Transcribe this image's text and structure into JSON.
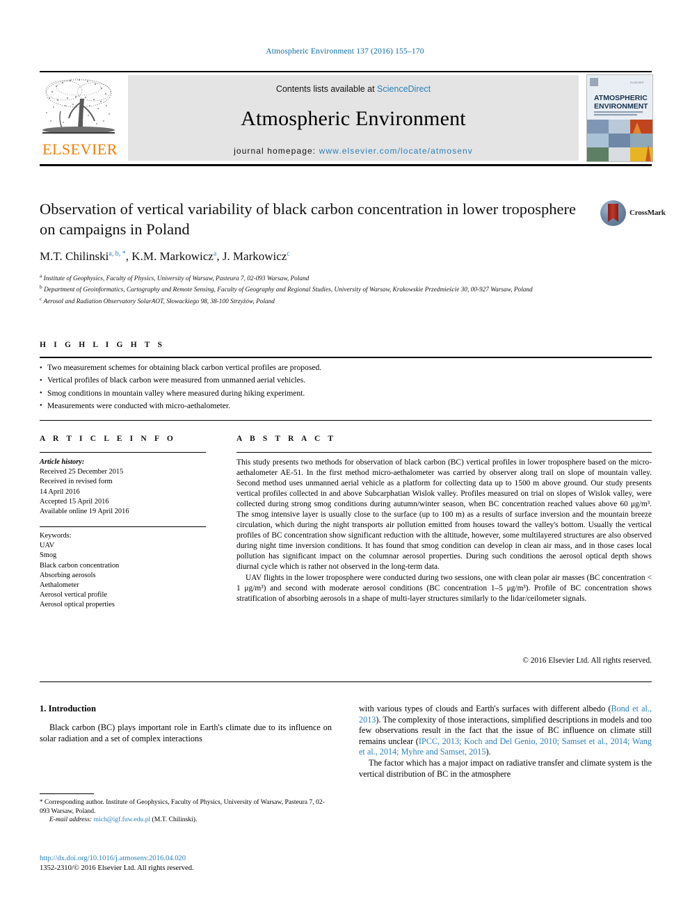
{
  "running_head": "Atmospheric Environment 137 (2016) 155–170",
  "masthead": {
    "contents_prefix": "Contents lists available at ",
    "sciencedirect": "ScienceDirect",
    "journal_title": "Atmospheric Environment",
    "homepage_prefix": "journal homepage: ",
    "homepage_url": "www.elsevier.com/locate/atmosenv",
    "publisher_wordmark": "ELSEVIER",
    "cover_title_line1": "ATMOSPHERIC",
    "cover_title_line2": "ENVIRONMENT"
  },
  "article": {
    "title": "Observation of vertical variability of black carbon concentration in lower troposphere on campaigns in Poland",
    "authors": [
      {
        "name": "M.T. Chilinski",
        "marks": "a, b, *"
      },
      {
        "name": "K.M. Markowicz",
        "marks": "a"
      },
      {
        "name": "J. Markowicz",
        "marks": "c"
      }
    ],
    "affiliations": [
      {
        "mark": "a",
        "text": "Institute of Geophysics, Faculty of Physics, University of Warsaw, Pasteura 7, 02-093 Warsaw, Poland"
      },
      {
        "mark": "b",
        "text": "Department of Geoinformatics, Cartography and Remote Sensing, Faculty of Geography and Regional Studies, University of Warsaw, Krakowskie Przedmieście 30, 00-927 Warsaw, Poland"
      },
      {
        "mark": "c",
        "text": "Aerosol and Radiation Observatory SolarAOT, Słowackiego 98, 38-100 Strzyżów, Poland"
      }
    ],
    "crossmark_label": "CrossMark"
  },
  "highlights": {
    "heading": "H I G H L I G H T S",
    "items": [
      "Two measurement schemes for obtaining black carbon vertical profiles are proposed.",
      "Vertical profiles of black carbon were measured from unmanned aerial vehicles.",
      "Smog conditions in mountain valley where measured during hiking experiment.",
      "Measurements were conducted with micro-aethalometer."
    ]
  },
  "article_info": {
    "heading": "A R T I C L E   I N F O",
    "history_label": "Article history:",
    "history": [
      "Received 25 December 2015",
      "Received in revised form",
      "14 April 2016",
      "Accepted 15 April 2016",
      "Available online 19 April 2016"
    ],
    "keywords_label": "Keywords:",
    "keywords": [
      "UAV",
      "Smog",
      "Black carbon concentration",
      "Absorbing aerosols",
      "Aethalometer",
      "Aerosol vertical profile",
      "Aerosol optical properties"
    ]
  },
  "abstract": {
    "heading": "A B S T R A C T",
    "paragraph1": "This study presents two methods for observation of black carbon (BC) vertical profiles in lower troposphere based on the micro-aethalometer AE-51. In the first method micro-aethalometer was carried by observer along trail on slope of mountain valley. Second method uses unmanned aerial vehicle as a platform for collecting data up to 1500 m above ground. Our study presents vertical profiles collected in and above Subcarphatian Wislok valley. Profiles measured on trial on slopes of Wislok valley, were collected during strong smog conditions during autumn/winter season, when BC concentration reached values above 60 μg/m³. The smog intensive layer is usually close to the surface (up to 100 m) as a results of surface inversion and the mountain breeze circulation, which during the night transports air pollution emitted from houses toward the valley's bottom. Usually the vertical profiles of BC concentration show significant reduction with the altitude, however, some multilayered structures are also observed during night time inversion conditions. It has found that smog condition can develop in clean air mass, and in those cases local pollution has significant impact on the columnar aerosol properties. During such conditions the aerosol optical depth shows diurnal cycle which is rather not observed in the long-term data.",
    "paragraph2": "UAV flights in the lower troposphere were conducted during two sessions, one with clean polar air masses (BC concentration < 1 μg/m³) and second with moderate aerosol conditions (BC concentration 1–5 μg/m³). Profile of BC concentration shows stratification of absorbing aerosols in a shape of multi-layer structures similarly to the lidar/ceilometer signals.",
    "copyright": "© 2016 Elsevier Ltd. All rights reserved."
  },
  "introduction": {
    "heading": "1.  Introduction",
    "left_p1_a": "Black carbon (BC) plays important role in Earth's climate due to its influence on solar radiation and a set of complex interactions",
    "right_p1_b_1": "with various types of clouds and Earth's surfaces with different albedo (",
    "right_ref_bond": "Bond et al., 2013",
    "right_p1_b_2": "). The complexity of those interactions, simplified descriptions in models and too few observations result in the fact that the issue of BC influence on climate still remains unclear (",
    "right_ref_list": "IPCC, 2013; Koch and Del Genio, 2010; Samset et al., 2014; Wang et al., 2014; Myhre and Samset, 2015",
    "right_p1_b_3": ").",
    "right_p2": "The factor which has a major impact on radiative transfer and climate system is the vertical distribution of BC in the atmosphere"
  },
  "footer": {
    "corresponding_star": "*",
    "corresponding": "Corresponding author. Institute of Geophysics, Faculty of Physics, University of Warsaw, Pasteura 7, 02-093 Warsaw, Poland.",
    "email_label": "E-mail address:",
    "email": "mich@igf.fuw.edu.pl",
    "email_owner": "(M.T. Chilinski).",
    "doi_url": "http://dx.doi.org/10.1016/j.atmosenv.2016.04.020",
    "issn_line": "1352-2310/© 2016 Elsevier Ltd. All rights reserved."
  },
  "colors": {
    "link": "#2a7fb8",
    "elsevier_orange": "#ef7d00",
    "band_gray": "#e4e4e4"
  }
}
